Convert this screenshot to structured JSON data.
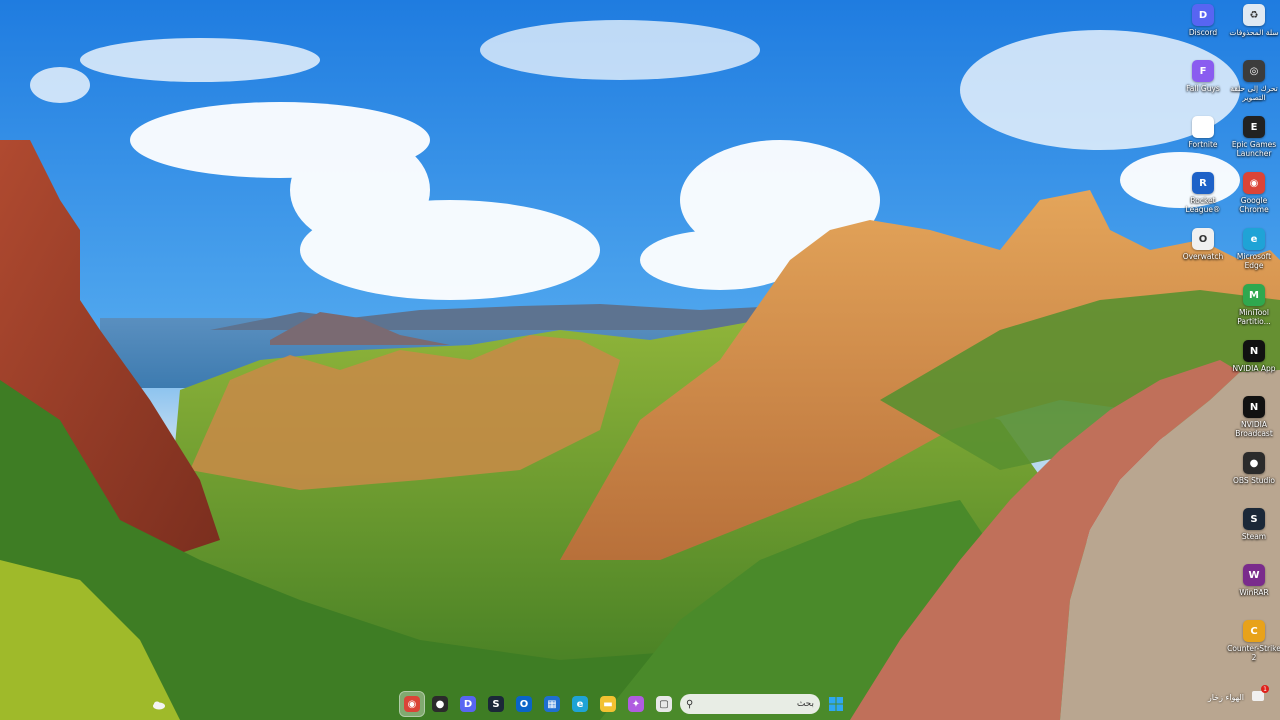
{
  "desktop": {
    "icons_col1": [
      {
        "label": "Discord",
        "icon": "discord-icon",
        "color": "#5865F2",
        "glyph": "D"
      },
      {
        "label": "Fall Guys",
        "icon": "fall-guys-icon",
        "color": "#8a5cf0",
        "glyph": "F"
      },
      {
        "label": "Fortnite",
        "icon": "file-icon",
        "color": "#ffffff",
        "glyph": ""
      },
      {
        "label": "Rocket League®",
        "icon": "rocket-league-icon",
        "color": "#1e62c8",
        "glyph": "R"
      },
      {
        "label": "Overwatch",
        "icon": "overwatch-icon",
        "color": "#f0f0f0",
        "glyph": "O"
      }
    ],
    "icons_col2": [
      {
        "label": "سلة المحذوفات",
        "icon": "recycle-bin-icon",
        "color": "#dfe9f3",
        "glyph": "♻"
      },
      {
        "label": "تحرك إلى حلقة التصوير",
        "icon": "capture-icon",
        "color": "#3c3c3c",
        "glyph": "◎"
      },
      {
        "label": "Epic Games Launcher",
        "icon": "epic-games-icon",
        "color": "#222222",
        "glyph": "E"
      },
      {
        "label": "Google Chrome",
        "icon": "chrome-icon",
        "color": "#db4437",
        "glyph": "◉"
      },
      {
        "label": "Microsoft Edge",
        "icon": "edge-icon",
        "color": "#1fa3d6",
        "glyph": "e"
      },
      {
        "label": "MiniTool Partitio...",
        "icon": "minitool-icon",
        "color": "#2fa84f",
        "glyph": "M"
      },
      {
        "label": "NVIDIA App",
        "icon": "nvidia-icon",
        "color": "#111111",
        "glyph": "N"
      },
      {
        "label": "NVIDIA Broadcast",
        "icon": "nvidia-broadcast-icon",
        "color": "#111111",
        "glyph": "N"
      },
      {
        "label": "OBS Studio",
        "icon": "obs-icon",
        "color": "#2b2b2b",
        "glyph": "●"
      },
      {
        "label": "Steam",
        "icon": "steam-icon",
        "color": "#1b2838",
        "glyph": "S"
      },
      {
        "label": "WinRAR",
        "icon": "winrar-icon",
        "color": "#7a2b8c",
        "glyph": "W"
      },
      {
        "label": "Counter-Strike 2",
        "icon": "counter-strike-icon",
        "color": "#e8a21a",
        "glyph": "C"
      }
    ]
  },
  "taskbar": {
    "apps": [
      {
        "name": "chrome",
        "icon": "chrome-icon",
        "color": "#db4437",
        "glyph": "◉",
        "active": true
      },
      {
        "name": "obs",
        "icon": "obs-icon",
        "color": "#2b2b2b",
        "glyph": "●",
        "active": false
      },
      {
        "name": "discord",
        "icon": "discord-icon",
        "color": "#5865F2",
        "glyph": "D",
        "active": false
      },
      {
        "name": "steam",
        "icon": "steam-icon",
        "color": "#1b2838",
        "glyph": "S",
        "active": false
      },
      {
        "name": "outlook",
        "icon": "outlook-icon",
        "color": "#0a64c8",
        "glyph": "O",
        "active": false
      },
      {
        "name": "store",
        "icon": "store-icon",
        "color": "#1f6fd0",
        "glyph": "▦",
        "active": false
      },
      {
        "name": "edge",
        "icon": "edge-icon",
        "color": "#1fa3d6",
        "glyph": "e",
        "active": false
      },
      {
        "name": "files",
        "icon": "folder-icon",
        "color": "#f2c232",
        "glyph": "▬",
        "active": false
      },
      {
        "name": "copilot",
        "icon": "copilot-icon",
        "color": "#b05ce0",
        "glyph": "✦",
        "active": false
      },
      {
        "name": "task-view",
        "icon": "task-view-icon",
        "color": "#e8e8e8",
        "glyph": "▢",
        "active": false
      }
    ],
    "search_placeholder": "بحث",
    "start_icon": "windows-start-icon"
  },
  "tray": {
    "clock_time": "الهواء زخار",
    "clock_sub": "",
    "notification_count": "1"
  }
}
